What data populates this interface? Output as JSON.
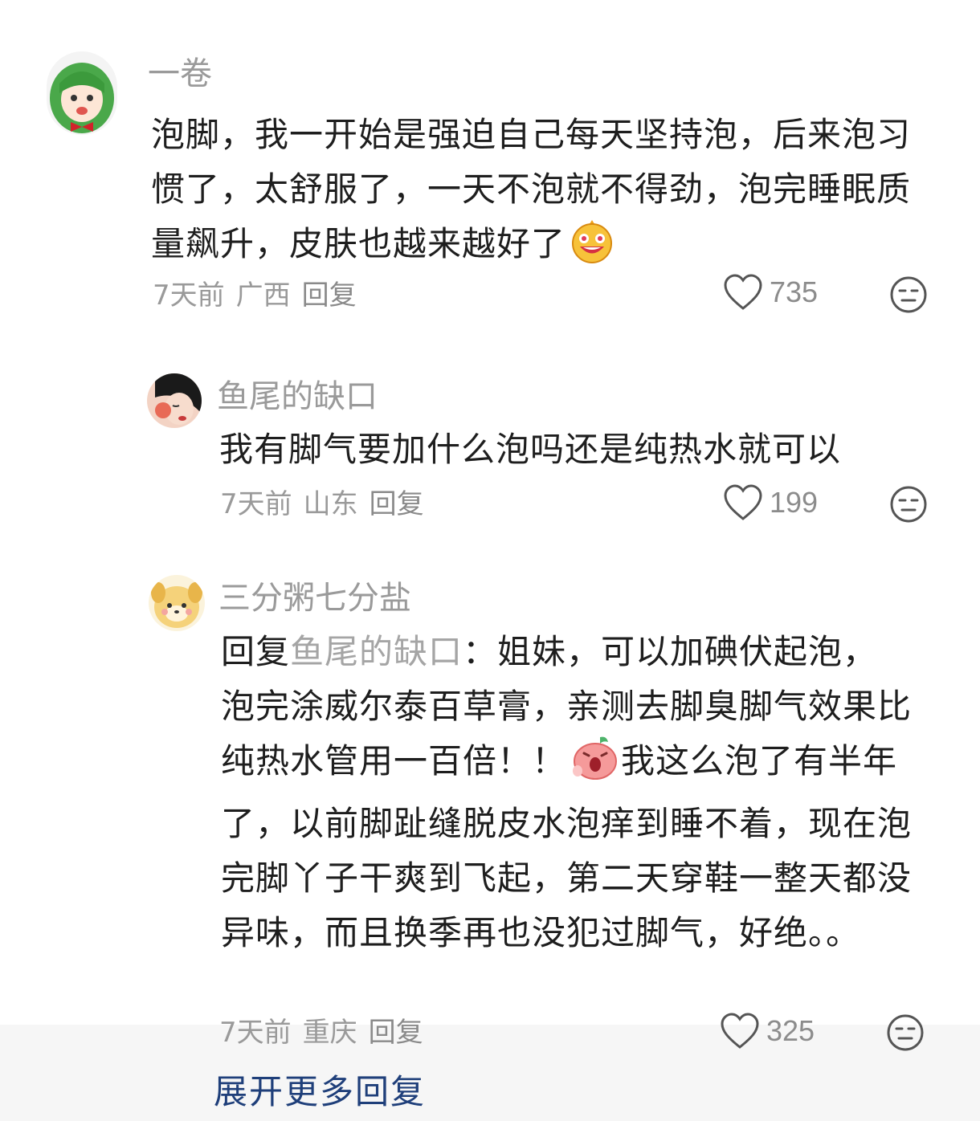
{
  "comments": [
    {
      "username": "一卷",
      "content": "泡脚，我一开始是强迫自己每天坚持泡，后来泡习惯了，太舒服了，一天不泡就不得劲，泡完睡眠质量飙升，皮肤也越来越好了",
      "time": "7天前",
      "location": "广西",
      "reply_label": "回复",
      "likes": "735"
    },
    {
      "username": "鱼尾的缺口",
      "content": "我有脚气要加什么泡吗还是纯热水就可以",
      "time": "7天前",
      "location": "山东",
      "reply_label": "回复",
      "likes": "199"
    },
    {
      "username": "三分粥七分盐",
      "reply_prefix": "回复",
      "mention": "鱼尾的缺口",
      "content_part1": "：姐妹，可以加碘伏起泡，泡完涂威尔泰百草膏，亲测去脚臭脚气效果比纯热水管用一百倍！！",
      "content_part2": "我这么泡了有半年了，以前脚趾缝脱皮水泡痒到睡不着，现在泡完脚丫子干爽到飞起，第二天穿鞋一整天都没异味，而且换季再也没犯过脚气，好绝。。",
      "time": "7天前",
      "location": "重庆",
      "reply_label": "回复",
      "likes": "325"
    }
  ],
  "more_replies_label": "展开更多回复",
  "colors": {
    "username": "#9a9a9a",
    "text": "#1e1e1e",
    "link": "#1f3f7a",
    "mention": "#a5a5a5"
  },
  "icons": [
    "heart-outline-icon",
    "neutral-face-icon",
    "laughing-emoji-icon",
    "surprised-emoji-icon"
  ]
}
